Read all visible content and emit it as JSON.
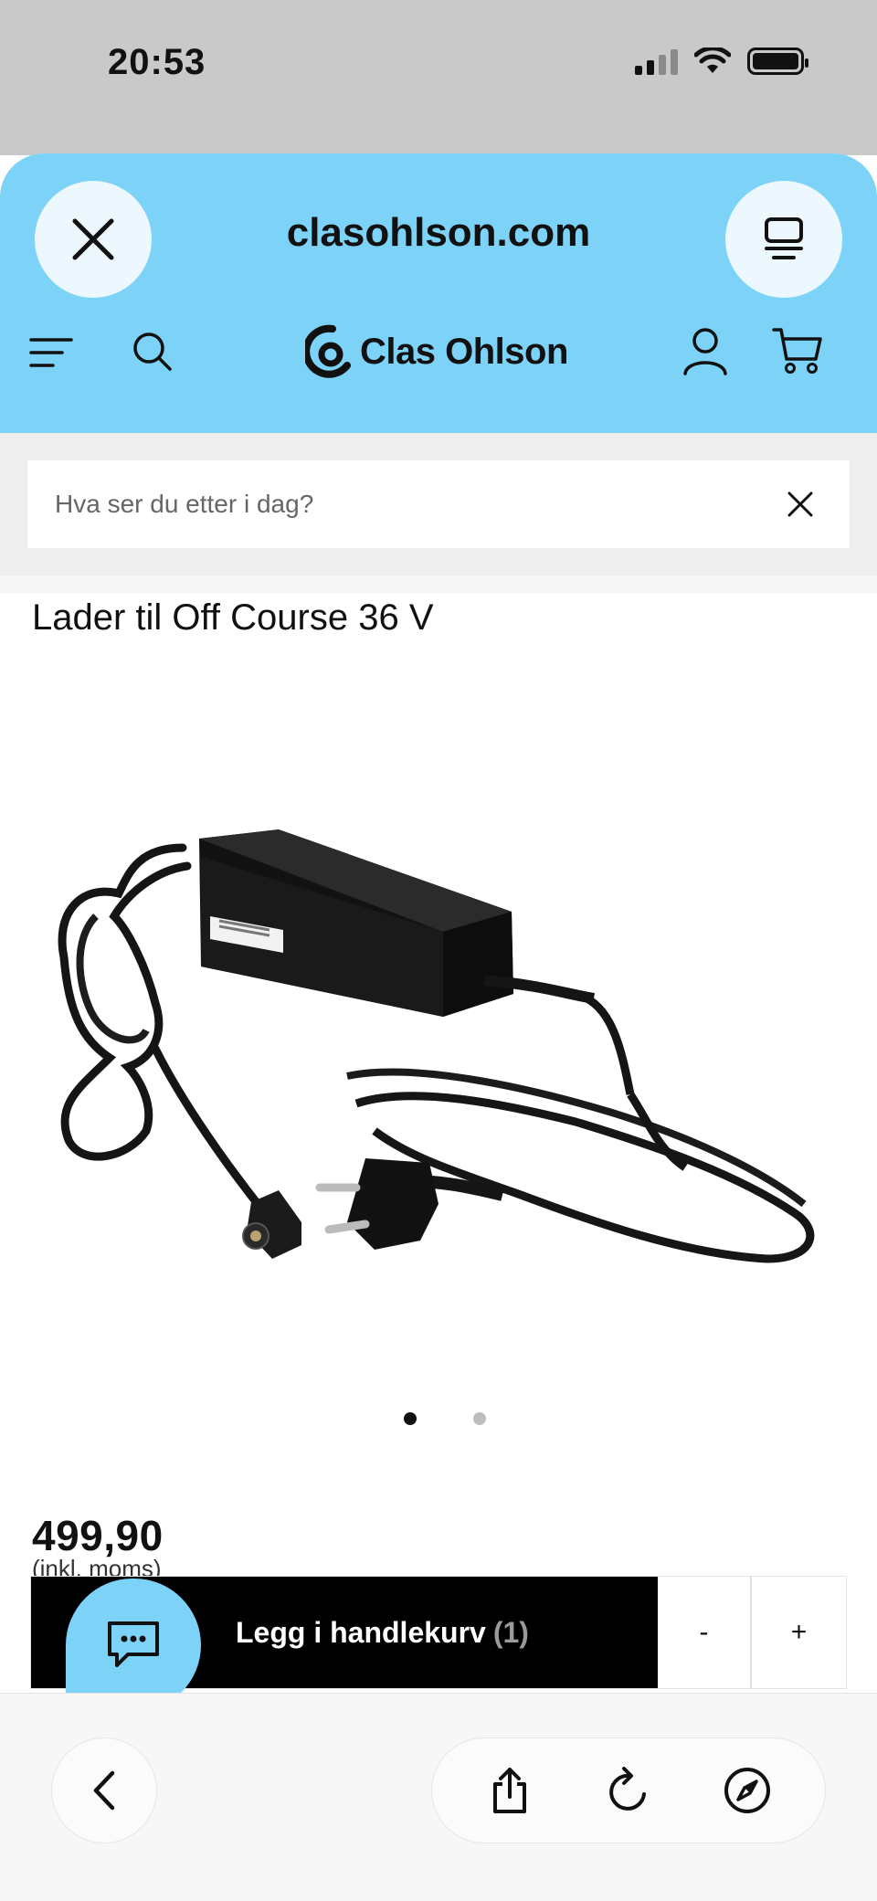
{
  "status_bar": {
    "time": "20:53",
    "icons": [
      "cellular-signal-icon",
      "wifi-icon",
      "battery-icon"
    ]
  },
  "browser": {
    "url": "clasohlson.com",
    "close_icon": "close-icon",
    "tabs_icon": "tabs-icon"
  },
  "site_header": {
    "logo_text": "Clas Ohlson",
    "icons": [
      "menu-icon",
      "search-icon",
      "account-icon",
      "cart-icon"
    ]
  },
  "search": {
    "placeholder": "Hva ser du etter i dag?"
  },
  "product": {
    "title": "Lader til Off Course 36 V",
    "image_pages": 2,
    "active_image": 1,
    "price": "499,90",
    "price_note": "(inkl. moms)"
  },
  "cart_bar": {
    "add_label": "Legg i handlekurv",
    "count": "(1)",
    "minus_label": "-",
    "plus_label": "+"
  },
  "toolbar": {
    "icons": [
      "back-icon",
      "share-icon",
      "reload-icon",
      "compass-icon"
    ]
  },
  "colors": {
    "accent": "#7dd3f7",
    "button_dark": "#000000"
  }
}
